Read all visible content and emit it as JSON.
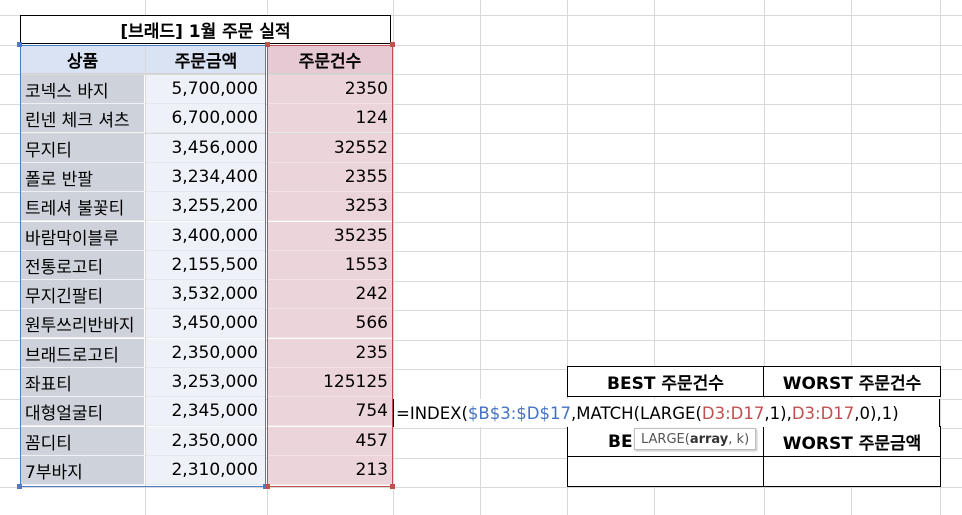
{
  "title": "[브래드] 1월 주문 실적",
  "headers": {
    "product": "상품",
    "amount": "주문금액",
    "count": "주문건수"
  },
  "rows": [
    {
      "product": "코넥스 바지",
      "amount": "5,700,000",
      "count": "2350"
    },
    {
      "product": "린넨 체크 셔츠",
      "amount": "6,700,000",
      "count": "124"
    },
    {
      "product": "무지티",
      "amount": "3,456,000",
      "count": "32552"
    },
    {
      "product": "폴로 반팔",
      "amount": "3,234,400",
      "count": "2355"
    },
    {
      "product": "트레셔 불꽃티",
      "amount": "3,255,200",
      "count": "3253"
    },
    {
      "product": "바람막이블루",
      "amount": "3,400,000",
      "count": "35235"
    },
    {
      "product": "전통로고티",
      "amount": "2,155,500",
      "count": "1553"
    },
    {
      "product": "무지긴팔티",
      "amount": "3,532,000",
      "count": "242"
    },
    {
      "product": "원투쓰리반바지",
      "amount": "3,450,000",
      "count": "566"
    },
    {
      "product": "브래드로고티",
      "amount": "2,350,000",
      "count": "235"
    },
    {
      "product": "좌표티",
      "amount": "3,253,000",
      "count": "125125"
    },
    {
      "product": "대형얼굴티",
      "amount": "2,345,000",
      "count": "754"
    },
    {
      "product": "꼼디티",
      "amount": "2,350,000",
      "count": "457"
    },
    {
      "product": "7부바지",
      "amount": "2,310,000",
      "count": "213"
    }
  ],
  "results": {
    "best_count": "BEST 주문건수",
    "worst_count": "WORST 주문건수",
    "best_amount_partial": "BES",
    "worst_amount": "WORST 주문금액"
  },
  "formula": {
    "p1": "=INDEX(",
    "p2": "$B$3:$D$17",
    "p3": ",MATCH(LARGE(",
    "p4": "D3:D17",
    "p5": ",1),",
    "p6": "D3:D17",
    "p7": ",0),1)"
  },
  "tooltip": {
    "fn": "LARGE(",
    "arg1": "array",
    "rest": ", k)"
  },
  "colors": {
    "accent_blue": "#4472c4",
    "accent_red": "#c0504d",
    "header_fill": "#dae3f3",
    "count_fill": "#ecd4db"
  }
}
